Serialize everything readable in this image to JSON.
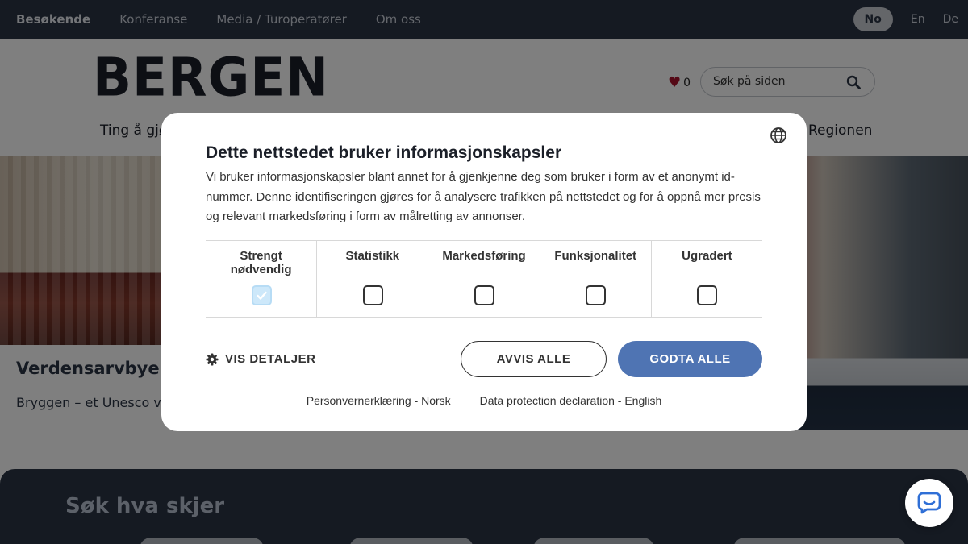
{
  "topnav": {
    "items": [
      "Besøkende",
      "Konferanse",
      "Media / Turoperatører",
      "Om oss"
    ],
    "languages": [
      "No",
      "En",
      "De"
    ]
  },
  "header": {
    "logo": "BERGEN",
    "favorites_count": "0",
    "search_placeholder": "Søk på siden",
    "nav_left": "Ting å gjø",
    "nav_right": "Regionen"
  },
  "hero": {
    "title": "Verdensarvbyen",
    "subtitle": "Bryggen – et Unesco ve"
  },
  "whatson": {
    "title": "Søk hva skjer"
  },
  "cookie_dialog": {
    "title": "Dette nettstedet bruker informasjonskapsler",
    "body": "Vi bruker informasjonskapsler blant annet for å gjenkjenne deg som bruker i form av et anonymt id-nummer. Denne identifiseringen gjøres for å analysere trafikken på nettstedet og for å oppnå mer presis og relevant markedsføring i form av målretting av annonser.",
    "categories": [
      {
        "label": "Strengt nødvendig",
        "checked": true
      },
      {
        "label": "Statistikk",
        "checked": false
      },
      {
        "label": "Markedsføring",
        "checked": false
      },
      {
        "label": "Funksjonalitet",
        "checked": false
      },
      {
        "label": "Ugradert",
        "checked": false
      }
    ],
    "details_label": "VIS DETALJER",
    "reject_label": "AVVIS ALLE",
    "accept_label": "GODTA ALLE",
    "link_no": "Personvernerklæring - Norsk",
    "link_en": "Data protection declaration - English",
    "accept_color": "#4f74b3"
  }
}
